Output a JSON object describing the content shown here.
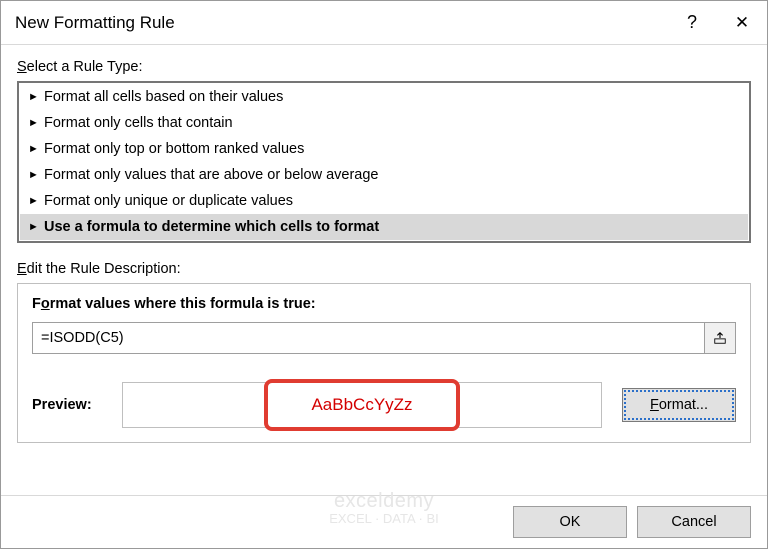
{
  "dialog": {
    "title": "New Formatting Rule",
    "help_symbol": "?",
    "close_symbol": "✕"
  },
  "rule_type": {
    "label_pre": "S",
    "label_post": "elect a Rule Type:",
    "items": [
      {
        "text": "Format all cells based on their values",
        "selected": false
      },
      {
        "text": "Format only cells that contain",
        "selected": false
      },
      {
        "text": "Format only top or bottom ranked values",
        "selected": false
      },
      {
        "text": "Format only values that are above or below average",
        "selected": false
      },
      {
        "text": "Format only unique or duplicate values",
        "selected": false
      },
      {
        "text": "Use a formula to determine which cells to format",
        "selected": true
      }
    ]
  },
  "rule_desc": {
    "label_pre": "E",
    "label_post": "dit the Rule Description:",
    "formula_label_pre": "F",
    "formula_label_mid": "o",
    "formula_label_post": "rmat values where this formula is true:",
    "formula_value": "=ISODD(C5)",
    "preview_label": "Preview:",
    "preview_text": "AaBbCcYyZz",
    "format_btn_pre": "",
    "format_btn_u": "F",
    "format_btn_post": "ormat..."
  },
  "footer": {
    "ok": "OK",
    "cancel": "Cancel"
  },
  "watermark": {
    "line1": "exceldemy",
    "line2": "EXCEL · DATA · BI"
  }
}
